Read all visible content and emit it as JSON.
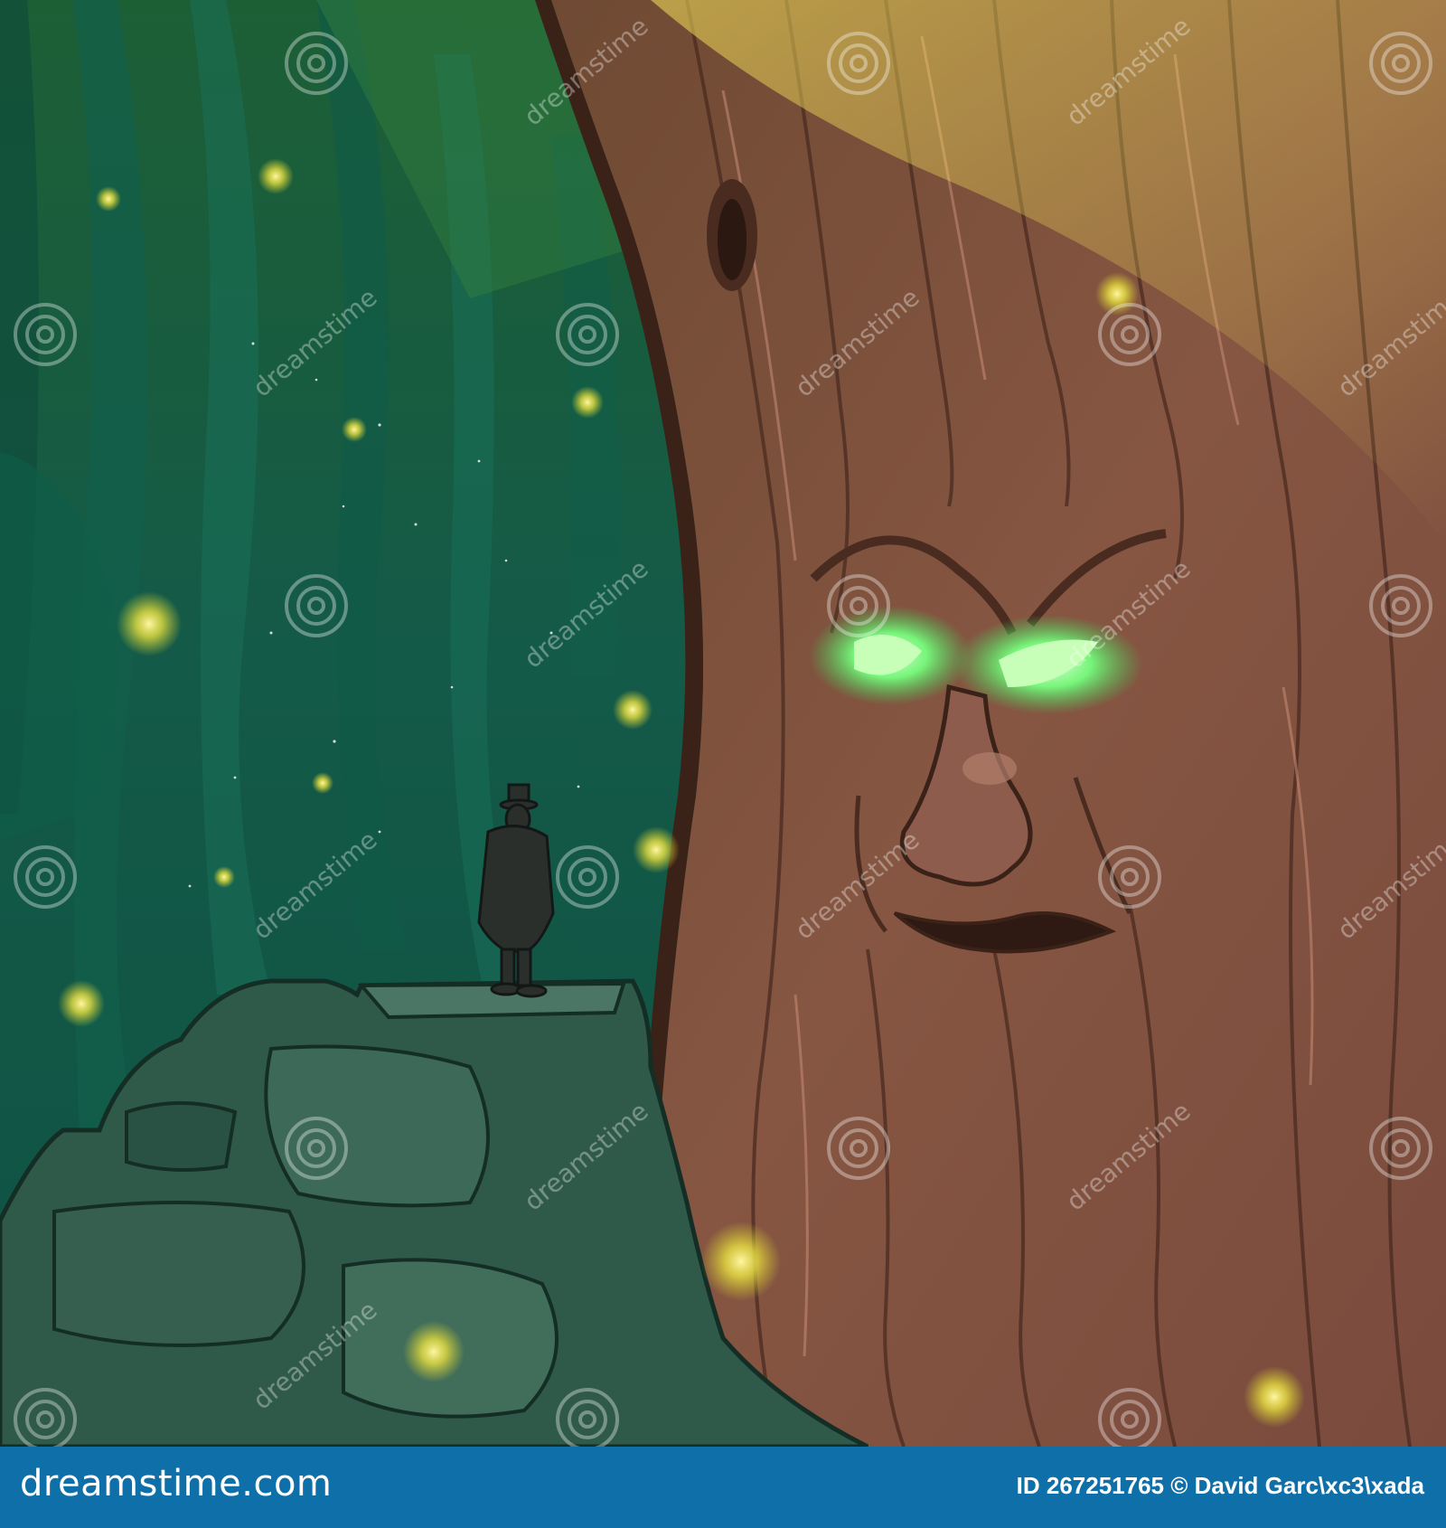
{
  "watermark": {
    "text": "dreamstime",
    "icon": "spiral-logo"
  },
  "footer": {
    "brand": "dreamstime.com",
    "credit": "ID 267251765 © David Garc\\xc3\\xada"
  },
  "colors": {
    "footer_bar": "#0f6fa8",
    "forest_dark": "#0c4a3c",
    "forest_mid": "#19725d",
    "bark": "#8b5a46",
    "eye_glow": "#8dff9b",
    "firefly": "#f3e64a"
  }
}
